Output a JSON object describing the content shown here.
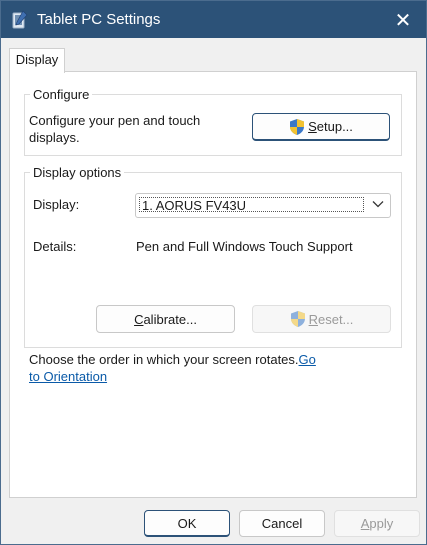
{
  "window": {
    "title": "Tablet PC Settings",
    "close_glyph": "✕",
    "app_icon": "tablet-pen-icon"
  },
  "tabs": [
    {
      "label": "Display",
      "selected": true
    }
  ],
  "configure": {
    "group_label": "Configure",
    "description_line1": "Configure your pen and touch",
    "description_line2": "displays.",
    "setup_button": {
      "prefix": "",
      "mnemonic": "S",
      "suffix": "etup...",
      "icon": "uac-shield-icon"
    }
  },
  "display_options": {
    "group_label": "Display options",
    "display_label": "Display:",
    "display_value": "1. AORUS FV43U",
    "details_label": "Details:",
    "details_value": "Pen and Full Windows Touch Support",
    "calibrate_button": {
      "prefix": "",
      "mnemonic": "C",
      "suffix": "alibrate..."
    },
    "reset_button": {
      "prefix": "",
      "mnemonic": "R",
      "suffix": "eset...",
      "icon": "uac-shield-icon",
      "enabled": false
    }
  },
  "orientation": {
    "text": "Choose the order in which your screen rotates.",
    "link_part1": "Go",
    "link_part2": "to Orientation"
  },
  "footer": {
    "ok_label": "OK",
    "cancel_label": "Cancel",
    "apply_prefix": "",
    "apply_mnemonic": "A",
    "apply_suffix": "pply",
    "apply_enabled": false
  },
  "colors": {
    "titlebar": "#2c5278",
    "accent_border": "#2c5278",
    "link": "#0a5aa8",
    "disabled_text": "#9a9a9a"
  }
}
